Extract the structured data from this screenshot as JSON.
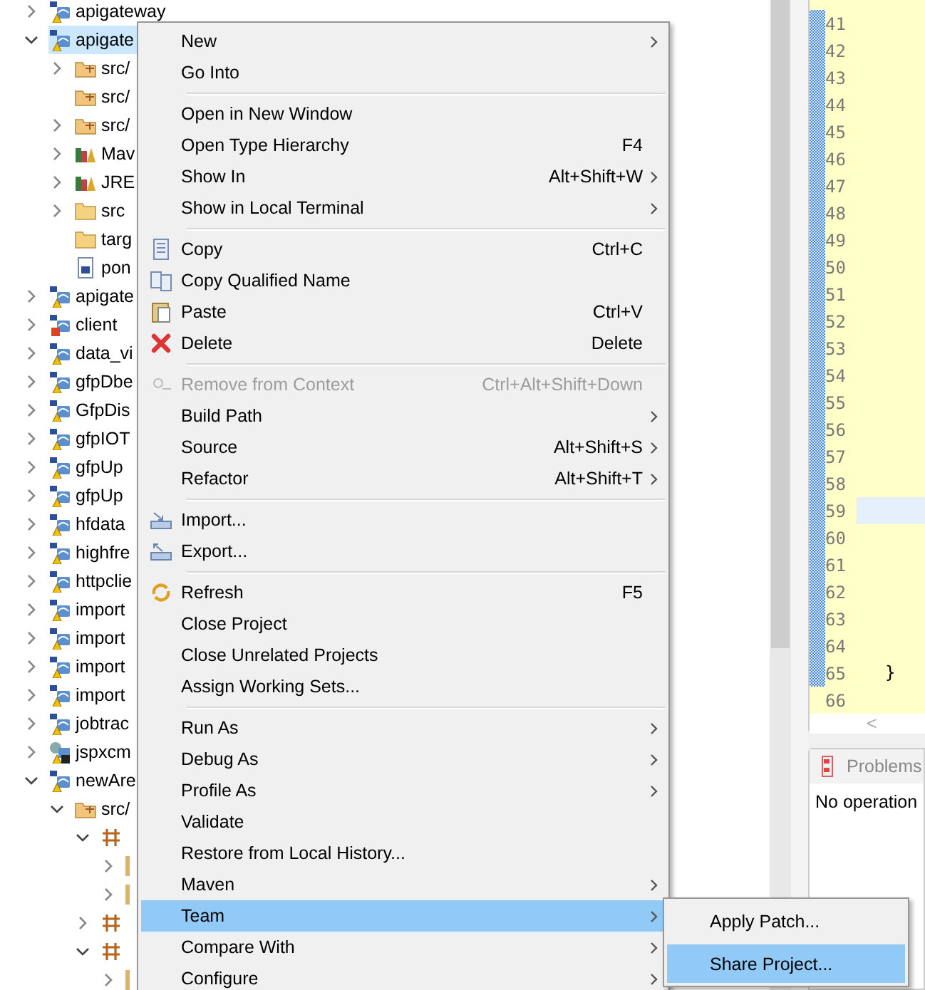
{
  "tree": [
    {
      "label": "apigateway",
      "kind": "project",
      "expanded": false,
      "selected": false
    },
    {
      "label": "apigate",
      "kind": "project",
      "expanded": true,
      "selected": true,
      "children": [
        {
          "label": "src/",
          "kind": "srcfolder",
          "expanded": false,
          "selected": false
        },
        {
          "label": "src/",
          "kind": "srcfolder",
          "selected": false
        },
        {
          "label": "src/",
          "kind": "srcfolder",
          "expanded": false,
          "selected": false
        },
        {
          "label": "Mav",
          "kind": "library",
          "expanded": false,
          "selected": false
        },
        {
          "label": "JRE",
          "kind": "library",
          "expanded": false,
          "selected": false
        },
        {
          "label": "src",
          "kind": "folder",
          "expanded": false,
          "selected": false
        },
        {
          "label": "targ",
          "kind": "folder",
          "selected": false
        },
        {
          "label": "pon",
          "kind": "file",
          "selected": false
        }
      ]
    },
    {
      "label": "apigate",
      "kind": "project",
      "expanded": false,
      "selected": false
    },
    {
      "label": "client",
      "kind": "broken",
      "expanded": false,
      "selected": false
    },
    {
      "label": "data_vi",
      "kind": "project",
      "expanded": false,
      "selected": false
    },
    {
      "label": "gfpDbe",
      "kind": "project",
      "expanded": false,
      "selected": false
    },
    {
      "label": "GfpDis",
      "kind": "project",
      "expanded": false,
      "selected": false
    },
    {
      "label": "gfpIOT",
      "kind": "project",
      "expanded": false,
      "selected": false
    },
    {
      "label": "gfpUp",
      "kind": "project",
      "expanded": false,
      "selected": false
    },
    {
      "label": "gfpUp",
      "kind": "project",
      "expanded": false,
      "selected": false
    },
    {
      "label": "hfdata",
      "kind": "project",
      "expanded": false,
      "selected": false
    },
    {
      "label": "highfre",
      "kind": "project",
      "expanded": false,
      "selected": false
    },
    {
      "label": "httpclie",
      "kind": "project",
      "expanded": false,
      "selected": false
    },
    {
      "label": "import",
      "kind": "project",
      "expanded": false,
      "selected": false
    },
    {
      "label": "import",
      "kind": "project",
      "expanded": false,
      "selected": false
    },
    {
      "label": "import",
      "kind": "project",
      "expanded": false,
      "selected": false
    },
    {
      "label": "import",
      "kind": "project",
      "expanded": false,
      "selected": false
    },
    {
      "label": "jobtrac",
      "kind": "project",
      "expanded": false,
      "selected": false
    },
    {
      "label": "jspxcm",
      "kind": "web",
      "expanded": false,
      "selected": false
    },
    {
      "label": "newAre",
      "kind": "project",
      "expanded": true,
      "selected": false,
      "children": [
        {
          "label": "src/",
          "kind": "srcfolder",
          "expanded": true,
          "selected": false,
          "children": [
            {
              "kind": "package",
              "expanded": true,
              "selected": false,
              "children": [
                {
                  "kind": "stub",
                  "expanded": false,
                  "selected": false
                },
                {
                  "kind": "stub",
                  "expanded": false,
                  "selected": false
                }
              ]
            },
            {
              "kind": "package",
              "expanded": false,
              "selected": false
            },
            {
              "kind": "package",
              "expanded": true,
              "selected": false,
              "children": [
                {
                  "kind": "stub",
                  "expanded": false,
                  "selected": false
                }
              ]
            }
          ]
        }
      ]
    }
  ],
  "editor": {
    "lines": [
      {
        "number": "41",
        "highlighted": false
      },
      {
        "number": "42",
        "highlighted": false
      },
      {
        "number": "43",
        "highlighted": false
      },
      {
        "number": "44",
        "highlighted": false
      },
      {
        "number": "45",
        "highlighted": false
      },
      {
        "number": "46",
        "highlighted": false
      },
      {
        "number": "47",
        "highlighted": false
      },
      {
        "number": "48",
        "highlighted": false
      },
      {
        "number": "49",
        "highlighted": false
      },
      {
        "number": "50",
        "highlighted": false
      },
      {
        "number": "51",
        "highlighted": false
      },
      {
        "number": "52",
        "highlighted": false
      },
      {
        "number": "53",
        "highlighted": false
      },
      {
        "number": "54",
        "highlighted": false
      },
      {
        "number": "55",
        "highlighted": false
      },
      {
        "number": "56",
        "highlighted": false
      },
      {
        "number": "57",
        "highlighted": false
      },
      {
        "number": "58",
        "highlighted": false
      },
      {
        "number": "59",
        "highlighted": true
      },
      {
        "number": "60",
        "highlighted": false
      },
      {
        "number": "61",
        "highlighted": false
      },
      {
        "number": "62",
        "highlighted": false
      },
      {
        "number": "63",
        "highlighted": false
      },
      {
        "number": "64",
        "highlighted": false
      },
      {
        "number": "65",
        "highlighted": false,
        "code": "}"
      },
      {
        "number": "66",
        "highlighted": false
      }
    ],
    "scroll_arrow": "<"
  },
  "bottom_panel": {
    "tabs": [
      {
        "label": "Problems",
        "selected": false
      }
    ],
    "message": "No operation"
  },
  "context_menu": {
    "items": [
      {
        "kind": "item",
        "label": "New",
        "submenu": true,
        "disabled": false,
        "selected": false
      },
      {
        "kind": "item",
        "label": "Go Into",
        "submenu": false,
        "disabled": false,
        "selected": false
      },
      {
        "kind": "separator"
      },
      {
        "kind": "item",
        "label": "Open in New Window",
        "submenu": false,
        "disabled": false,
        "selected": false
      },
      {
        "kind": "item",
        "label": "Open Type Hierarchy",
        "shortcut": "F4",
        "submenu": false,
        "disabled": false,
        "selected": false
      },
      {
        "kind": "item",
        "label": "Show In",
        "shortcut": "Alt+Shift+W",
        "submenu": true,
        "disabled": false,
        "selected": false
      },
      {
        "kind": "item",
        "label": "Show in Local Terminal",
        "submenu": true,
        "disabled": false,
        "selected": false
      },
      {
        "kind": "separator"
      },
      {
        "kind": "copy",
        "label": "Copy",
        "shortcut": "Ctrl+C",
        "submenu": false,
        "disabled": false,
        "selected": false
      },
      {
        "kind": "qualified",
        "label": "Copy Qualified Name",
        "submenu": false,
        "disabled": false,
        "selected": false
      },
      {
        "kind": "paste",
        "label": "Paste",
        "shortcut": "Ctrl+V",
        "submenu": false,
        "disabled": false,
        "selected": false
      },
      {
        "kind": "delete",
        "label": "Delete",
        "shortcut": "Delete",
        "submenu": false,
        "disabled": false,
        "selected": false
      },
      {
        "kind": "separator"
      },
      {
        "kind": "remove",
        "label": "Remove from Context",
        "shortcut": "Ctrl+Alt+Shift+Down",
        "submenu": false,
        "disabled": true,
        "selected": false
      },
      {
        "kind": "item",
        "label": "Build Path",
        "submenu": true,
        "disabled": false,
        "selected": false
      },
      {
        "kind": "item",
        "label": "Source",
        "shortcut": "Alt+Shift+S",
        "submenu": true,
        "disabled": false,
        "selected": false
      },
      {
        "kind": "item",
        "label": "Refactor",
        "shortcut": "Alt+Shift+T",
        "submenu": true,
        "disabled": false,
        "selected": false
      },
      {
        "kind": "separator"
      },
      {
        "kind": "import",
        "label": "Import...",
        "submenu": false,
        "disabled": false,
        "selected": false
      },
      {
        "kind": "export",
        "label": "Export...",
        "submenu": false,
        "disabled": false,
        "selected": false
      },
      {
        "kind": "separator"
      },
      {
        "kind": "refresh",
        "label": "Refresh",
        "shortcut": "F5",
        "submenu": false,
        "disabled": false,
        "selected": false
      },
      {
        "kind": "item",
        "label": "Close Project",
        "submenu": false,
        "disabled": false,
        "selected": false
      },
      {
        "kind": "item",
        "label": "Close Unrelated Projects",
        "submenu": false,
        "disabled": false,
        "selected": false
      },
      {
        "kind": "item",
        "label": "Assign Working Sets...",
        "submenu": false,
        "disabled": false,
        "selected": false
      },
      {
        "kind": "separator"
      },
      {
        "kind": "item",
        "label": "Run As",
        "submenu": true,
        "disabled": false,
        "selected": false
      },
      {
        "kind": "item",
        "label": "Debug As",
        "submenu": true,
        "disabled": false,
        "selected": false
      },
      {
        "kind": "item",
        "label": "Profile As",
        "submenu": true,
        "disabled": false,
        "selected": false
      },
      {
        "kind": "item",
        "label": "Validate",
        "submenu": false,
        "disabled": false,
        "selected": false
      },
      {
        "kind": "item",
        "label": "Restore from Local History...",
        "submenu": false,
        "disabled": false,
        "selected": false
      },
      {
        "kind": "item",
        "label": "Maven",
        "submenu": true,
        "disabled": false,
        "selected": false
      },
      {
        "kind": "item",
        "label": "Team",
        "submenu": true,
        "disabled": false,
        "selected": true
      },
      {
        "kind": "item",
        "label": "Compare With",
        "submenu": true,
        "disabled": false,
        "selected": false
      },
      {
        "kind": "item",
        "label": "Configure",
        "submenu": true,
        "disabled": false,
        "selected": false
      }
    ]
  },
  "submenu": {
    "items": [
      {
        "label": "Apply Patch...",
        "selected": false
      },
      {
        "label": "Share Project...",
        "selected": true
      }
    ]
  }
}
